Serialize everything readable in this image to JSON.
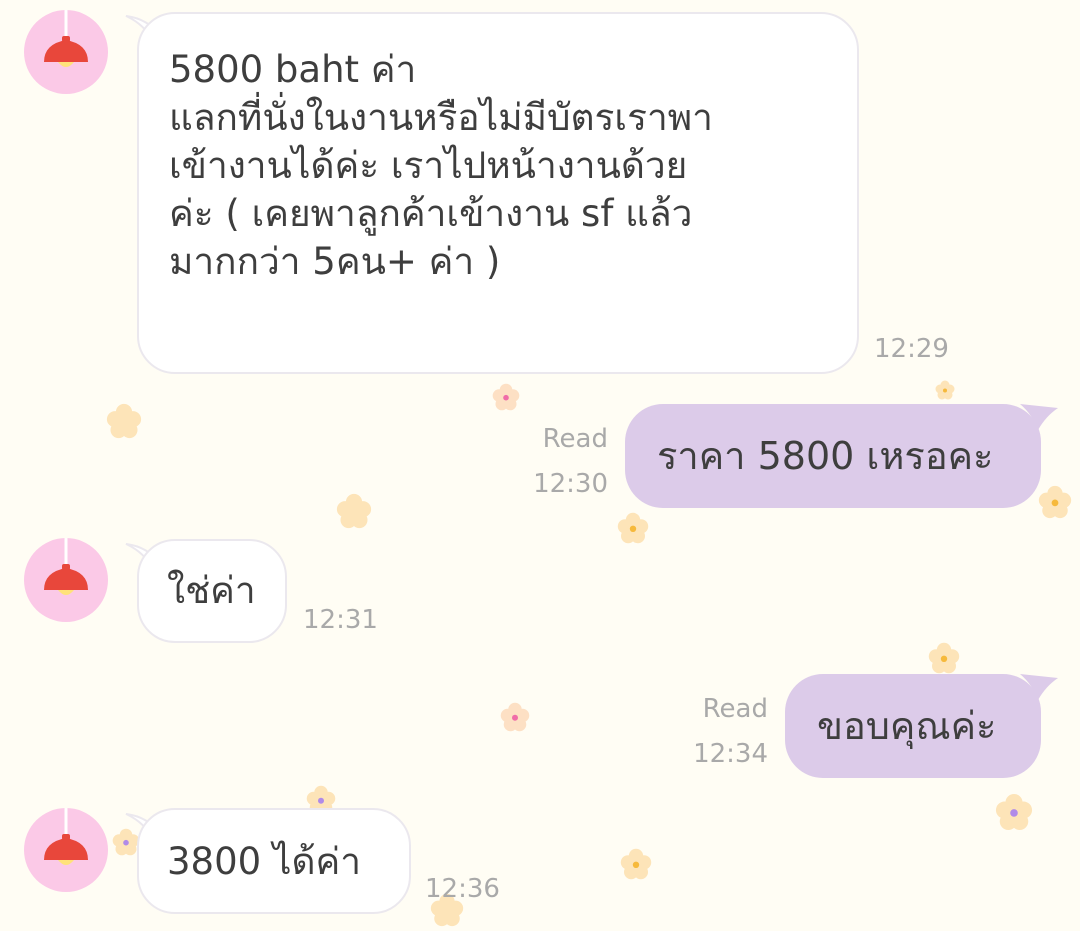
{
  "colors": {
    "background": "#fffdf4",
    "incoming_bubble": "#ffffff",
    "outgoing_bubble": "#dccbe9",
    "avatar_bg": "#fbc9e7",
    "lamp": "#e8473b",
    "meta_text": "#a9a9a9"
  },
  "avatar_icon": "lamp-icon",
  "messages": [
    {
      "direction": "incoming",
      "lines": [
        "5800 baht ค่า",
        "แลกที่นั่งในงานหรือไม่มีบัตรเราพา",
        "เข้างานได้ค่ะ เราไปหน้างานด้วย",
        "ค่ะ ( เคยพาลูกค้าเข้างาน sf แล้ว",
        "มากกว่า 5คน+ ค่า )"
      ],
      "time": "12:29"
    },
    {
      "direction": "outgoing",
      "text": "ราคา 5800 เหรอคะ",
      "read": "Read",
      "time": "12:30"
    },
    {
      "direction": "incoming",
      "text": "ใช่ค่า",
      "time": "12:31"
    },
    {
      "direction": "outgoing",
      "text": "ขอบคุณค่ะ",
      "read": "Read",
      "time": "12:34"
    },
    {
      "direction": "incoming",
      "text": "3800 ได้ค่า",
      "time": "12:36"
    }
  ]
}
